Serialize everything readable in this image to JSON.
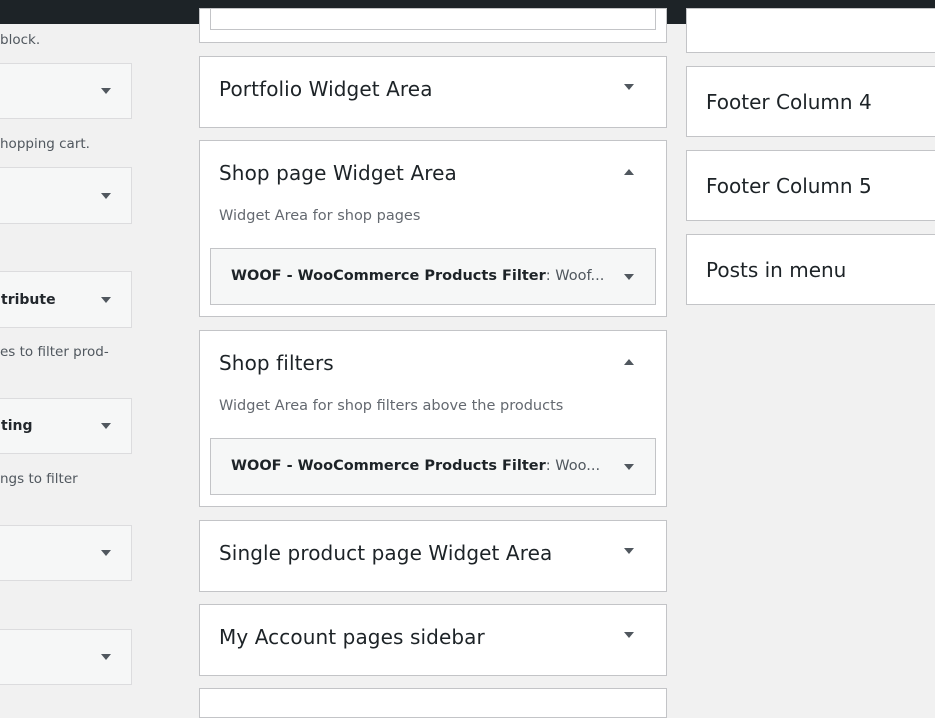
{
  "left": {
    "desc_top": "block.",
    "desc_cart": "hopping cart.",
    "widget_attr_label": "tribute",
    "desc_attr": "es to filter prod-",
    "widget_rating_label": "ting",
    "desc_rating": "ngs to filter"
  },
  "sidebars": {
    "portfolio": {
      "title": "Portfolio Widget Area"
    },
    "shop_page": {
      "title": "Shop page Widget Area",
      "description": "Widget Area for shop pages",
      "widget_title": "WOOF - WooCommerce Products Filter",
      "widget_instance": ": Woof..."
    },
    "shop_filters": {
      "title": "Shop filters",
      "description": "Widget Area for shop filters above the products",
      "widget_title": "WOOF - WooCommerce Products Filter",
      "widget_instance": ": Woo..."
    },
    "single_product": {
      "title": "Single product page Widget Area"
    },
    "my_account": {
      "title": "My Account pages sidebar"
    }
  },
  "right": {
    "footer4": "Footer Column 4",
    "footer5": "Footer Column 5",
    "posts_menu": "Posts in menu"
  },
  "icons": {
    "collapsed": "triangle-down-icon",
    "expanded": "triangle-up-icon"
  }
}
